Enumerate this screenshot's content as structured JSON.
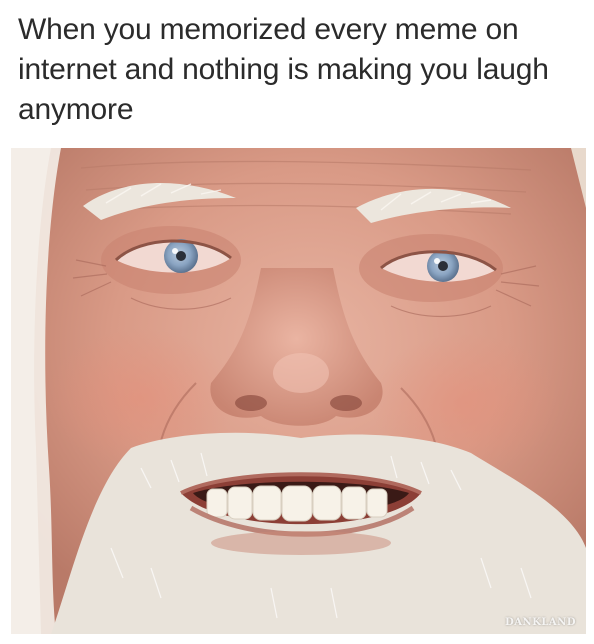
{
  "caption": {
    "text": "When you memorized every meme on internet and nothing is making you laugh anymore"
  },
  "photo": {
    "watermark": "DANKLAND"
  },
  "colors": {
    "text": "#2b2b2b",
    "background": "#ffffff",
    "skin": "#d99a86",
    "beard": "#f2efe9",
    "iris": "#8aa4c2"
  }
}
